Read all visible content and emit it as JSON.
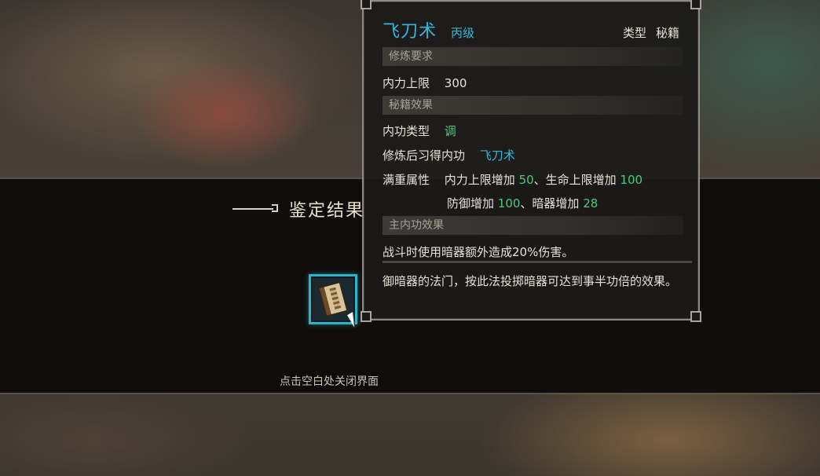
{
  "result": {
    "title": "鉴定结果",
    "close_hint": "点击空白处关闭界面"
  },
  "item": {
    "icon": "scroll-book-icon"
  },
  "tooltip": {
    "name": "飞刀术",
    "grade": "丙级",
    "type_label": "类型",
    "type_value": "秘籍",
    "sections": {
      "requirements": "修炼要求",
      "effects": "秘籍效果",
      "main_effect": "主内功效果"
    },
    "requirement": {
      "label": "内力上限",
      "value": "300"
    },
    "internal_type": {
      "label": "内功类型",
      "value": "调"
    },
    "learned": {
      "label": "修炼后习得内功",
      "value": "飞刀术"
    },
    "full_attr": {
      "label": "满重属性",
      "line1_a": "内力上限增加 ",
      "line1_a_val": "50",
      "line1_b": "、生命上限增加 ",
      "line1_b_val": "100",
      "line2_a": "防御增加 ",
      "line2_a_val": "100",
      "line2_b": "、暗器增加 ",
      "line2_b_val": "28"
    },
    "main_effect_text": "战斗时使用暗器额外造成20%伤害。",
    "description": "御暗器的法门，按此法投掷暗器可达到事半功倍的效果。"
  },
  "colors": {
    "accent_cyan": "#35b8d4",
    "bonus_green": "#4fc97a",
    "slot_border": "#2fb3c4"
  }
}
